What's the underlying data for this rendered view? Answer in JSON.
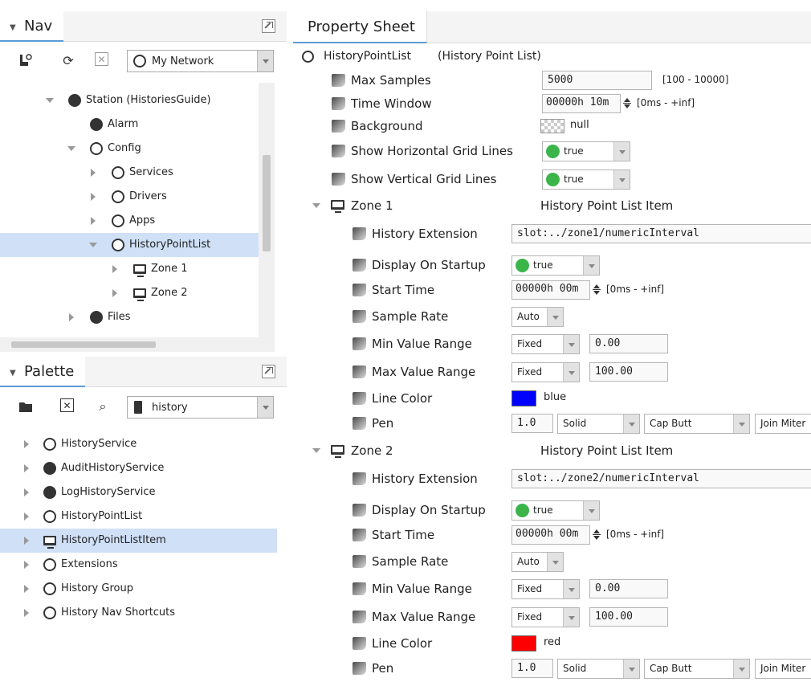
{
  "nav": {
    "title": "Nav",
    "network_combo": "My Network",
    "tree": [
      {
        "label": "Station (HistoriesGuide)",
        "icon": "station-icon",
        "depth": 0,
        "expander": "open"
      },
      {
        "label": "Alarm",
        "icon": "bell-icon",
        "depth": 1,
        "expander": "none"
      },
      {
        "label": "Config",
        "icon": "database-icon",
        "depth": 1,
        "expander": "open"
      },
      {
        "label": "Services",
        "icon": "services-icon",
        "depth": 2,
        "expander": "closed"
      },
      {
        "label": "Drivers",
        "icon": "drivers-icon",
        "depth": 2,
        "expander": "closed"
      },
      {
        "label": "Apps",
        "icon": "apps-icon",
        "depth": 2,
        "expander": "closed"
      },
      {
        "label": "HistoryPointList",
        "icon": "history-point-list-icon",
        "depth": 2,
        "expander": "open",
        "selected": true
      },
      {
        "label": "Zone 1",
        "icon": "monitor-icon",
        "depth": 3,
        "expander": "closed"
      },
      {
        "label": "Zone 2",
        "icon": "monitor-icon",
        "depth": 3,
        "expander": "closed"
      },
      {
        "label": "Files",
        "icon": "files-icon",
        "depth": 1,
        "expander": "closed"
      }
    ]
  },
  "palette": {
    "title": "Palette",
    "module_combo": "history",
    "items": [
      {
        "label": "HistoryService",
        "icon": "history-service-icon"
      },
      {
        "label": "AuditHistoryService",
        "icon": "audit-history-service-icon"
      },
      {
        "label": "LogHistoryService",
        "icon": "log-history-service-icon"
      },
      {
        "label": "HistoryPointList",
        "icon": "history-point-list-icon"
      },
      {
        "label": "HistoryPointListItem",
        "icon": "monitor-icon",
        "selected": true
      },
      {
        "label": "Extensions",
        "icon": "extensions-icon"
      },
      {
        "label": "History Group",
        "icon": "history-group-icon"
      },
      {
        "label": "History Nav Shortcuts",
        "icon": "history-nav-shortcuts-icon"
      }
    ]
  },
  "sheet": {
    "tab": "Property Sheet",
    "root_label": "HistoryPointList",
    "root_type": "(History Point List)",
    "max_samples": {
      "label": "Max Samples",
      "value": "5000",
      "range": "[100 - 10000]"
    },
    "time_window": {
      "label": "Time Window",
      "value": "00000h 10m",
      "range": "[0ms - +inf]"
    },
    "background": {
      "label": "Background",
      "value": "null"
    },
    "h_grid": {
      "label": "Show Horizontal Grid Lines",
      "value": "true"
    },
    "v_grid": {
      "label": "Show Vertical Grid Lines",
      "value": "true"
    },
    "zones": [
      {
        "name": "Zone 1",
        "type": "History Point List Item",
        "history_extension": {
          "label": "History Extension",
          "value": "slot:../zone1/numericInterval"
        },
        "display_on_startup": {
          "label": "Display On Startup",
          "value": "true"
        },
        "start_time": {
          "label": "Start Time",
          "value": "00000h 00m",
          "range": "[0ms - +inf]"
        },
        "sample_rate": {
          "label": "Sample Rate",
          "value": "Auto"
        },
        "min_value_range": {
          "label": "Min Value Range",
          "mode": "Fixed",
          "value": "0.00"
        },
        "max_value_range": {
          "label": "Max Value Range",
          "mode": "Fixed",
          "value": "100.00"
        },
        "line_color": {
          "label": "Line Color",
          "value": "blue",
          "color": "#0000ff"
        },
        "pen": {
          "label": "Pen",
          "width": "1.0",
          "style": "Solid",
          "cap": "Cap Butt",
          "join": "Join Miter"
        }
      },
      {
        "name": "Zone 2",
        "type": "History Point List Item",
        "history_extension": {
          "label": "History Extension",
          "value": "slot:../zone2/numericInterval"
        },
        "display_on_startup": {
          "label": "Display On Startup",
          "value": "true"
        },
        "start_time": {
          "label": "Start Time",
          "value": "00000h 00m",
          "range": "[0ms - +inf]"
        },
        "sample_rate": {
          "label": "Sample Rate",
          "value": "Auto"
        },
        "min_value_range": {
          "label": "Min Value Range",
          "mode": "Fixed",
          "value": "0.00"
        },
        "max_value_range": {
          "label": "Max Value Range",
          "mode": "Fixed",
          "value": "100.00"
        },
        "line_color": {
          "label": "Line Color",
          "value": "red",
          "color": "#ff0000"
        },
        "pen": {
          "label": "Pen",
          "width": "1.0",
          "style": "Solid",
          "cap": "Cap Butt",
          "join": "Join Miter"
        }
      }
    ]
  }
}
